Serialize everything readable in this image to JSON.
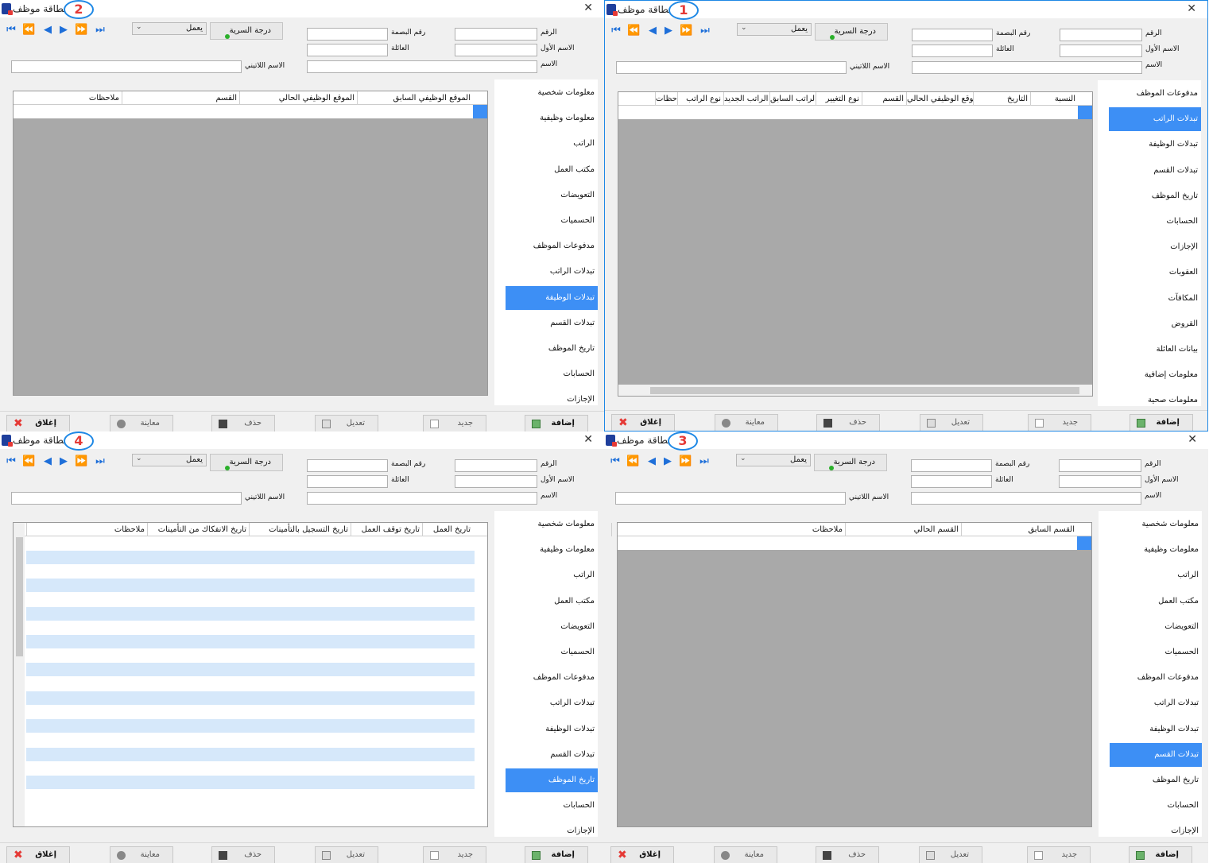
{
  "windows": [
    {
      "id": "w2",
      "badge": "2",
      "title": "بطاقة موظف",
      "columns": [
        "الموقع الوظيفي السابق",
        "الموقع الوظيفي الحالي",
        "القسم",
        "ملاحظات"
      ],
      "menu": [
        "معلومات شخصية",
        "معلومات وظيفية",
        "الراتب",
        "مكتب العمل",
        "التعويضات",
        "الحسميات",
        "مدفوعات الموظف",
        "تبدلات الراتب",
        "تبدلات الوظيفة",
        "تبدلات القسم",
        "تاريخ الموظف",
        "الحسابات",
        "الإجازات"
      ],
      "selected": 8
    },
    {
      "id": "w1",
      "badge": "1",
      "title": "بطاقة موظف",
      "columns": [
        "النسبة",
        "التاريخ",
        "الموقع الوظيفي الحالي",
        "القسم",
        "نوع التغيير",
        "الراتب السابق",
        "الراتب الجديد",
        "نوع الراتب",
        "ملاحظات"
      ],
      "menu": [
        "مدفوعات الموظف",
        "تبدلات الراتب",
        "تبدلات الوظيفة",
        "تبدلات القسم",
        "تاريخ الموظف",
        "الحسابات",
        "الإجازات",
        "العقوبات",
        "المكافآت",
        "القروض",
        "بيانات العائلة",
        "معلومات إضافية",
        "معلومات صحية"
      ],
      "selected": 1
    },
    {
      "id": "w4",
      "badge": "4",
      "title": "بطاقة موظف",
      "columns": [
        "تاريخ العمل",
        "تاريخ توقف العمل",
        "تاريخ التسجيل بالتأمينات",
        "تاريخ الانفكاك من التأمينات",
        "ملاحظات"
      ],
      "menu": [
        "معلومات شخصية",
        "معلومات وظيفية",
        "الراتب",
        "مكتب العمل",
        "التعويضات",
        "الحسميات",
        "مدفوعات الموظف",
        "تبدلات الراتب",
        "تبدلات الوظيفة",
        "تبدلات القسم",
        "تاريخ الموظف",
        "الحسابات",
        "الإجازات"
      ],
      "selected": 10
    },
    {
      "id": "w3",
      "badge": "3",
      "title": "بطاقة موظف",
      "columns": [
        "القسم السابق",
        "القسم الحالي",
        "ملاحظات"
      ],
      "menu": [
        "معلومات شخصية",
        "معلومات وظيفية",
        "الراتب",
        "مكتب العمل",
        "التعويضات",
        "الحسميات",
        "مدفوعات الموظف",
        "تبدلات الراتب",
        "تبدلات الوظيفة",
        "تبدلات القسم",
        "تاريخ الموظف",
        "الحسابات",
        "الإجازات"
      ],
      "selected": 9
    }
  ],
  "header": {
    "status_value": "يعمل",
    "secrecy_label": "درجة السرية",
    "labels": {
      "number": "الرقم",
      "fingerprint": "رقم البصمة",
      "first_name": "الاسم الأول",
      "family": "العائلة",
      "name": "الاسم",
      "latin_name": "الاسم اللاتيني"
    }
  },
  "toolbar": {
    "add": "إضافة",
    "new": "جديد",
    "edit": "تعديل",
    "delete": "حذف",
    "preview": "معاينة",
    "close": "إغلاق"
  },
  "icons": {
    "nav": [
      "first-icon",
      "prev-page-icon",
      "prev-icon",
      "next-icon",
      "next-page-icon",
      "last-icon"
    ],
    "close": "close-icon"
  },
  "colors": {
    "accent": "#3d8ff5",
    "badge_border": "#1e88e5",
    "badge_text": "#e53935",
    "grid_bg": "#a9a9a9"
  }
}
